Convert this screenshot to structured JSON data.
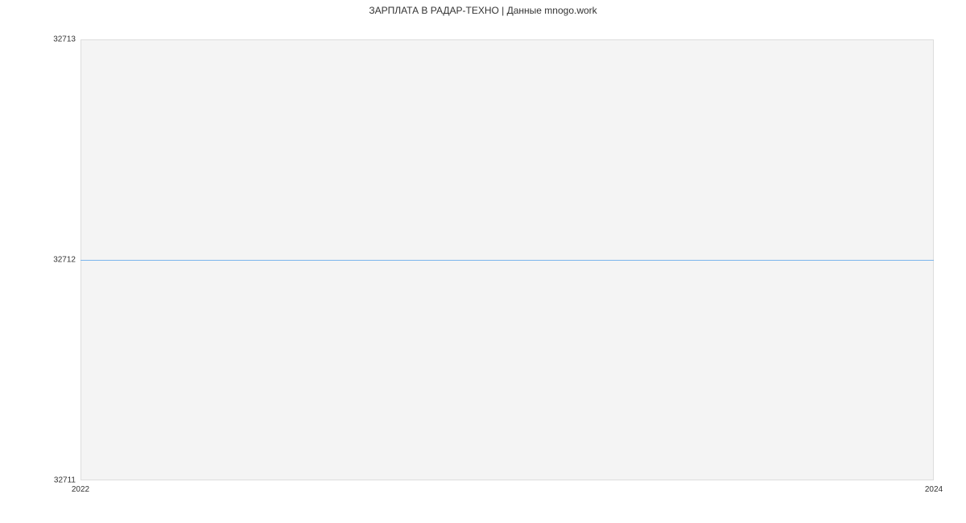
{
  "chart_data": {
    "type": "line",
    "title": "ЗАРПЛАТА В РАДАР-ТЕХНО | Данные mnogo.work",
    "xlabel": "",
    "ylabel": "",
    "xlim": [
      2022,
      2024
    ],
    "ylim": [
      32711,
      32713
    ],
    "y_ticks": [
      32711,
      32712,
      32713
    ],
    "x_ticks": [
      2022,
      2024
    ],
    "series": [
      {
        "name": "salary",
        "color": "#7cb5ec",
        "x": [
          2022,
          2024
        ],
        "values": [
          32712,
          32712
        ]
      }
    ]
  }
}
